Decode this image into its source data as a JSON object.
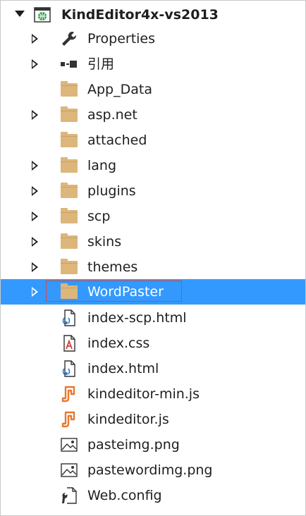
{
  "project": {
    "name": "KindEditor4x-vs2013",
    "icon": "web-globe-icon"
  },
  "items": [
    {
      "label": "Properties",
      "icon": "wrench-icon",
      "expandable": true
    },
    {
      "label": "引用",
      "icon": "references-icon",
      "expandable": true
    },
    {
      "label": "App_Data",
      "icon": "folder-icon",
      "expandable": false
    },
    {
      "label": "asp.net",
      "icon": "folder-icon",
      "expandable": true
    },
    {
      "label": "attached",
      "icon": "folder-icon",
      "expandable": false
    },
    {
      "label": "lang",
      "icon": "folder-icon",
      "expandable": true
    },
    {
      "label": "plugins",
      "icon": "folder-icon",
      "expandable": true
    },
    {
      "label": "scp",
      "icon": "folder-icon",
      "expandable": true
    },
    {
      "label": "skins",
      "icon": "folder-icon",
      "expandable": true
    },
    {
      "label": "themes",
      "icon": "folder-icon",
      "expandable": true
    },
    {
      "label": "WordPaster",
      "icon": "folder-icon",
      "expandable": true,
      "selected": true
    },
    {
      "label": "index-scp.html",
      "icon": "html-file-icon",
      "expandable": false
    },
    {
      "label": "index.css",
      "icon": "css-file-icon",
      "expandable": false
    },
    {
      "label": "index.html",
      "icon": "html-file-icon",
      "expandable": false
    },
    {
      "label": "kindeditor-min.js",
      "icon": "js-file-icon",
      "expandable": false
    },
    {
      "label": "kindeditor.js",
      "icon": "js-file-icon",
      "expandable": false
    },
    {
      "label": "pasteimg.png",
      "icon": "image-file-icon",
      "expandable": false
    },
    {
      "label": "pastewordimg.png",
      "icon": "image-file-icon",
      "expandable": false
    },
    {
      "label": "Web.config",
      "icon": "config-file-icon",
      "expandable": false
    }
  ],
  "colors": {
    "selection": "#3399ff",
    "folder": "#dcb67a",
    "highlight_box": "#e0463c",
    "js_icon": "#e8772e",
    "html_icon": "#1e7bd6"
  }
}
